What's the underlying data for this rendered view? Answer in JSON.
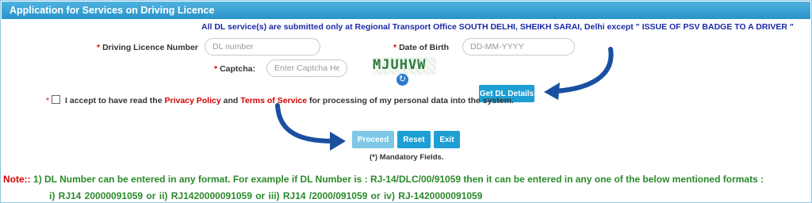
{
  "header": {
    "title": "Application for Services on Driving Licence"
  },
  "notice": "All DL service(s) are submitted only at Regional Transport Office SOUTH DELHI, SHEIKH SARAI, Delhi except \" ISSUE OF PSV BADGE TO A DRIVER \"",
  "form": {
    "required_mark": "*",
    "dl_label": "Driving Licence Number",
    "dl_placeholder": "DL number",
    "dl_value": "",
    "dob_label": "Date of Birth",
    "dob_placeholder": "DD-MM-YYYY",
    "dob_value": "",
    "captcha_label": "Captcha:",
    "captcha_placeholder": "Enter Captcha Here",
    "captcha_value": "",
    "captcha_text": "MJUHVW",
    "refresh_icon": "refresh-icon"
  },
  "buttons": {
    "get_details": "Get DL Details",
    "proceed": "Proceed",
    "reset": "Reset",
    "exit": "Exit"
  },
  "accept": {
    "text1": "I accept to have read the",
    "privacy": "Privacy Policy",
    "and": "and",
    "terms": "Terms of Service",
    "text2": "for processing of my personal data into the system."
  },
  "mandatory": "(*) Mandatory Fields.",
  "note": {
    "label": "Note::",
    "text": "1) DL Number can be entered in any format. For example if DL Number is : RJ-14/DLC/00/91059 then it can be entered in any one of the below mentioned formats :",
    "formats": "i) RJ14 20000091059    or    ii) RJ1420000091059    or    iii) RJ14 /2000/091059    or    iv) RJ-1420000091059"
  },
  "colors": {
    "header": "#2a92c9",
    "button": "#1e9fd4",
    "note": "#2a8a2a",
    "link": "#d40000",
    "arrow": "#1a4fa0"
  }
}
